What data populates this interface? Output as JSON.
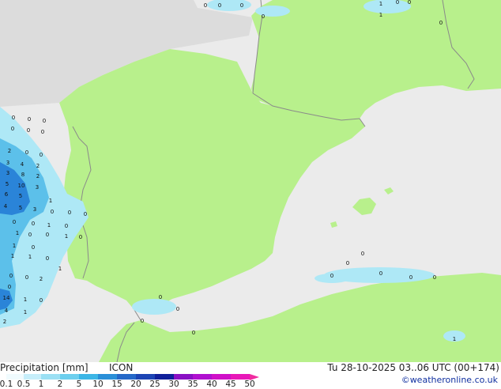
{
  "map": {
    "colors": {
      "sea": "#ebebeb",
      "land": "#b8f08c",
      "offgrid": "#dcdcdc",
      "border": "#8a8a8a",
      "precip_light": "#aee8f6",
      "precip_mid": "#5cc0ea",
      "precip_heavy": "#2a84d8"
    },
    "value_labels": [
      {
        "text": "0"
      },
      {
        "text": "0"
      },
      {
        "text": "0"
      },
      {
        "text": "1"
      },
      {
        "text": "0"
      },
      {
        "text": "0"
      },
      {
        "text": "0"
      },
      {
        "text": "1"
      },
      {
        "text": "0"
      },
      {
        "text": "0"
      },
      {
        "text": "0"
      },
      {
        "text": "0"
      },
      {
        "text": "0"
      },
      {
        "text": "0"
      },
      {
        "text": "0"
      },
      {
        "text": "2"
      },
      {
        "text": "0"
      },
      {
        "text": "0"
      },
      {
        "text": "3"
      },
      {
        "text": "4"
      },
      {
        "text": "2"
      },
      {
        "text": "3"
      },
      {
        "text": "8"
      },
      {
        "text": "2"
      },
      {
        "text": "5"
      },
      {
        "text": "10"
      },
      {
        "text": "3"
      },
      {
        "text": "6"
      },
      {
        "text": "5"
      },
      {
        "text": "1"
      },
      {
        "text": "0"
      },
      {
        "text": "4"
      },
      {
        "text": "5"
      },
      {
        "text": "3"
      },
      {
        "text": "0"
      },
      {
        "text": "0"
      },
      {
        "text": "0"
      },
      {
        "text": "0"
      },
      {
        "text": "1"
      },
      {
        "text": "0"
      },
      {
        "text": "1"
      },
      {
        "text": "0"
      },
      {
        "text": "0"
      },
      {
        "text": "1"
      },
      {
        "text": "0"
      },
      {
        "text": "1"
      },
      {
        "text": "0"
      },
      {
        "text": "1"
      },
      {
        "text": "1"
      },
      {
        "text": "0"
      },
      {
        "text": "1"
      },
      {
        "text": "0"
      },
      {
        "text": "0"
      },
      {
        "text": "2"
      },
      {
        "text": "0"
      },
      {
        "text": "14"
      },
      {
        "text": "1"
      },
      {
        "text": "0"
      },
      {
        "text": "4"
      },
      {
        "text": "1"
      },
      {
        "text": "2"
      },
      {
        "text": "0"
      },
      {
        "text": "0"
      },
      {
        "text": "0"
      },
      {
        "text": "0"
      },
      {
        "text": "0"
      },
      {
        "text": "0"
      },
      {
        "text": "0"
      },
      {
        "text": "0"
      },
      {
        "text": "0"
      },
      {
        "text": "0"
      },
      {
        "text": "1"
      }
    ]
  },
  "legend": {
    "title": "Precipitation [mm]",
    "model": "ICON",
    "valid_time": "Tu 28-10-2025 03..06 UTC (00+174)",
    "credit": "©weatheronline.co.uk",
    "ticks": [
      "0.1",
      "0.5",
      "1",
      "2",
      "5",
      "10",
      "15",
      "20",
      "25",
      "30",
      "35",
      "40",
      "45",
      "50"
    ],
    "colors": [
      "#f0fbfe",
      "#c6eefa",
      "#9be0f4",
      "#6ccfee",
      "#3cb6e6",
      "#2a8fd8",
      "#2568c8",
      "#1c44b4",
      "#10209a",
      "#8a10c4",
      "#b010d0",
      "#d010c8",
      "#e818b8",
      "#f02ca0"
    ]
  }
}
